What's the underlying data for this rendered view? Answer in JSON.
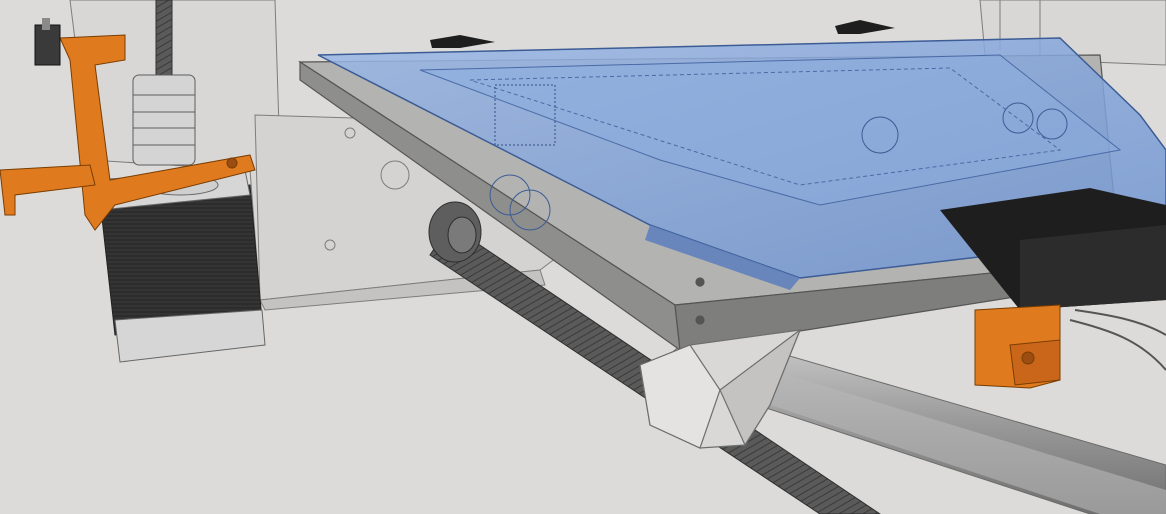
{
  "scene": {
    "kind": "3D CAD render",
    "description_visible": false,
    "colors": {
      "background": "#dcdbd9",
      "frame": "#d6d5d3",
      "frame_edge": "#7d7d7d",
      "bed_glass": "#7fa1d8",
      "bed_glass_edge": "#3c5c95",
      "plate_aluminum": "#a7a7a6",
      "plate_edge": "#555555",
      "printed_part_orange": "#e0781f",
      "stepper_motor": "#2b2b2b",
      "motor_endcap": "#d9d9d9",
      "rod": "#9c9c9c",
      "threaded_rod": "#555555",
      "coupler": "#cfcfcf",
      "black_clip": "#1e1e1e"
    }
  }
}
